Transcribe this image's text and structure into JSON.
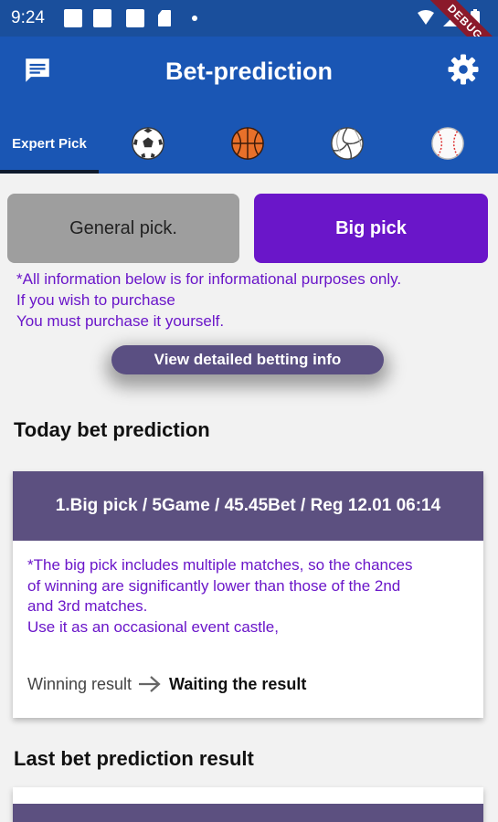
{
  "status_bar": {
    "time": "9:24",
    "debug_label": "DEBUG"
  },
  "app_bar": {
    "title": "Bet-prediction",
    "left_icon": "chat-icon",
    "right_icon": "gear-icon",
    "color": "#1a56b4"
  },
  "tabs": [
    {
      "label": "Expert Pick",
      "selected": true
    },
    {
      "icon": "soccer-ball-icon"
    },
    {
      "icon": "basketball-icon"
    },
    {
      "icon": "volleyball-icon"
    },
    {
      "icon": "baseball-icon"
    }
  ],
  "pick_buttons": {
    "general": "General pick.",
    "big": "Big pick",
    "selected": "big",
    "selected_color": "#6a16c9"
  },
  "notice": {
    "line1": "*All information below is for informational purposes only.",
    "line2": "If you wish to purchase",
    "line3": "You must purchase it yourself."
  },
  "detail_button": "View detailed betting info",
  "today": {
    "section_title": "Today bet prediction",
    "card_title": "1.Big pick / 5Game / 45.45Bet / Reg 12.01 06:14",
    "desc": [
      "*The big pick includes multiple matches, so the chances",
      "of winning are significantly lower than those of the 2nd",
      "and 3rd matches.",
      "Use it as an occasional event castle,"
    ],
    "result_label": "Winning result",
    "result_value": "Waiting the result"
  },
  "last": {
    "section_title": "Last bet prediction result"
  }
}
